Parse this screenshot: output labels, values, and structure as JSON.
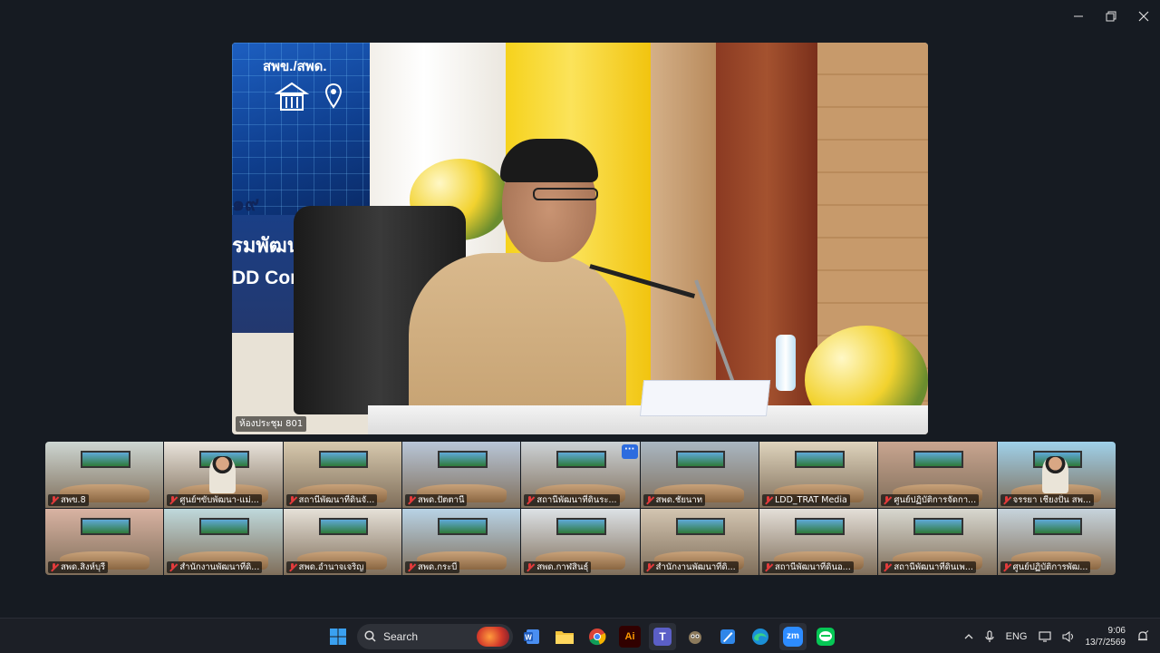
{
  "speaker": {
    "room_label": "ห้องประชุม 801",
    "banner": {
      "line1": "สพข./สพด.",
      "line2": "๑๙",
      "line3": "รมพัฒนา",
      "line4": "DD Confe"
    }
  },
  "gallery": {
    "tiles": [
      {
        "label": "สพข.8",
        "scene": "#cdd6d2"
      },
      {
        "label": "ศูนย์ฯขับพัฒนา-แม่...",
        "scene": "#e9e4dc"
      },
      {
        "label": "สถานีพัฒนาที่ดินจั...",
        "scene": "#d7c9ae"
      },
      {
        "label": "สพด.ปัตตานี",
        "scene": "#b8c6d8"
      },
      {
        "label": "สถานีพัฒนาที่ดินระ...",
        "scene": "#ccd2d6",
        "more": "···"
      },
      {
        "label": "สพด.ชัยนาท",
        "scene": "#a9b7c2"
      },
      {
        "label": "LDD_TRAT Media",
        "scene": "#dfd4bd"
      },
      {
        "label": "ศูนย์ปฏิบัติการจัดกา...",
        "scene": "#c9a590"
      },
      {
        "label": "จรรยา เชียงปั่น สพ...",
        "scene": "#9fd1ea"
      },
      {
        "label": "สพด.สิงห์บุรี",
        "scene": "#d9b3a3"
      },
      {
        "label": "สำนักงานพัฒนาที่ดิ...",
        "scene": "#bfd9dc"
      },
      {
        "label": "สพด.อำนาจเจริญ",
        "scene": "#e6e1d8"
      },
      {
        "label": "สพด.กระบี่",
        "scene": "#b8d3e6"
      },
      {
        "label": "สพด.กาฬสินธุ์",
        "scene": "#dde2e6"
      },
      {
        "label": "สำนักงานพัฒนาที่ดิ...",
        "scene": "#d3c5b1"
      },
      {
        "label": "สถานีพัฒนาที่ดินอ...",
        "scene": "#e4dfd8"
      },
      {
        "label": "สถานีพัฒนาที่ดินเพ...",
        "scene": "#d8d8d0"
      },
      {
        "label": "ศูนย์ปฏิบัติการพัฒ...",
        "scene": "#c7d4dc"
      }
    ]
  },
  "taskbar": {
    "search_placeholder": "Search",
    "apps": [
      "windows-start",
      "word",
      "file-explorer",
      "chrome",
      "illustrator",
      "teams",
      "gimp",
      "paint",
      "edge",
      "zoom",
      "line"
    ],
    "zoom_label": "zm",
    "illustrator_label": "Ai",
    "teams_label": "T",
    "tray": {
      "language": "ENG",
      "time": "9:06",
      "date": "13/7/2569"
    }
  }
}
